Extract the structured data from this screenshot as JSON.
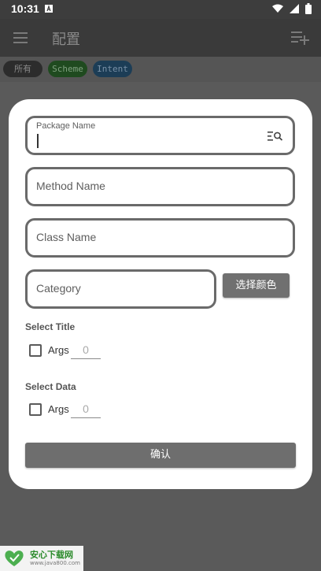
{
  "status_bar": {
    "time": "10:31"
  },
  "app_bar": {
    "title": "配置"
  },
  "chips": {
    "all": "所有",
    "scheme": "Scheme",
    "intent": "Intent"
  },
  "dialog": {
    "package_label": "Package Name",
    "method_label": "Method Name",
    "class_label": "Class Name",
    "category_label": "Category",
    "color_button": "选择颜色",
    "select_title": "Select Title",
    "select_data": "Select Data",
    "title_args_label": "Args",
    "title_args_value": "0",
    "data_args_label": "Args",
    "data_args_value": "0",
    "confirm": "确认"
  },
  "watermark": {
    "brand": "安心下载网",
    "url": "www.java800.com"
  },
  "colors": {
    "accent_dark": "#6e6e6e",
    "scheme_chip": "#1f4a1f",
    "intent_chip": "#1c3d56"
  },
  "icons": [
    "notification-icon",
    "wifi-icon",
    "signal-icon",
    "battery-icon",
    "menu-icon",
    "playlist-add-icon",
    "search-list-icon",
    "checkbox-icon"
  ]
}
